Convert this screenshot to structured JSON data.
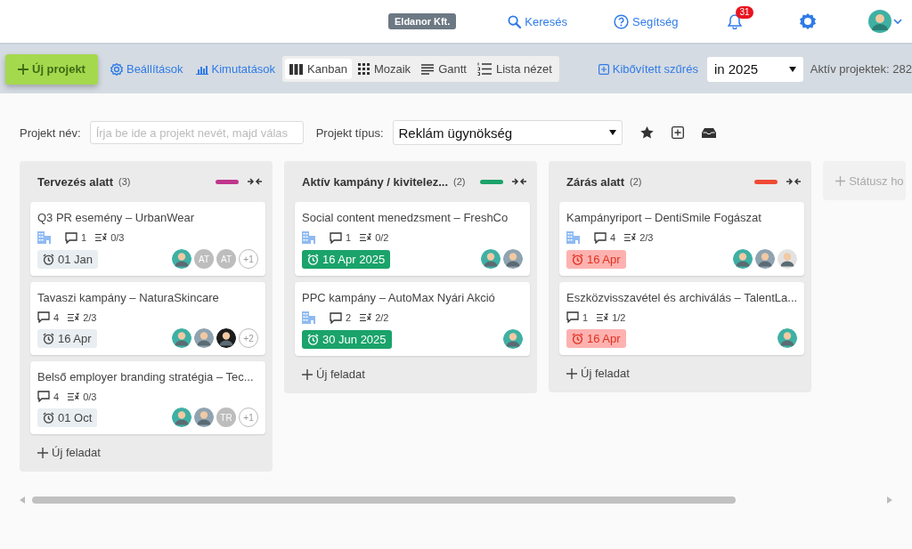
{
  "topbar": {
    "company": "Eldanor Kft.",
    "search": "Keresés",
    "help": "Segítség",
    "notifications": "31"
  },
  "toolbar": {
    "new_project": "Új projekt",
    "settings": "Beállítások",
    "reports": "Kimutatások",
    "views": [
      {
        "label": "Kanban",
        "kind": "kanban",
        "selected": true
      },
      {
        "label": "Mozaik",
        "kind": "grid",
        "selected": false
      },
      {
        "label": "Gantt",
        "kind": "gantt",
        "selected": false
      },
      {
        "label": "Lista nézet",
        "kind": "list",
        "selected": false
      }
    ],
    "advanced_filter": "Kibővített szűrés",
    "year": "in 2025",
    "active_projects": "Aktív projektek: 282"
  },
  "filters": {
    "name_label": "Projekt név:",
    "name_placeholder": "Írja be ide a projekt nevét, majd válas",
    "type_label": "Projekt típus:",
    "type_value": "Reklám ügynökség"
  },
  "columns": [
    {
      "title": "Tervezés alatt",
      "count": "(3)",
      "color": "#c0368c",
      "add_task": "Új feladat",
      "cards": [
        {
          "title": "Q3 PR esemény – UrbanWear",
          "client": true,
          "comments": "1",
          "subtasks": "0/3",
          "due": "01 Jan",
          "overdue": false,
          "on_track": false,
          "avatars": [
            {
              "kind": "person",
              "color": "#3fb0a4"
            },
            {
              "kind": "initials",
              "text": "AT"
            },
            {
              "kind": "initials",
              "text": "AT"
            },
            {
              "kind": "more",
              "text": "+1"
            }
          ]
        },
        {
          "title": "Tavaszi kampány – NaturaSkincare",
          "client": false,
          "comments": "4",
          "subtasks": "2/3",
          "due": "16 Apr",
          "overdue": false,
          "on_track": false,
          "avatars": [
            {
              "kind": "person",
              "color": "#3fb0a4"
            },
            {
              "kind": "person",
              "color": "#8fa3b0"
            },
            {
              "kind": "person",
              "color": "#1c1c1c"
            },
            {
              "kind": "more",
              "text": "+2"
            }
          ]
        },
        {
          "title": "Belső employer branding stratégia – Tec...",
          "client": false,
          "comments": "4",
          "subtasks": "0/3",
          "due": "01 Oct",
          "overdue": false,
          "on_track": false,
          "avatars": [
            {
              "kind": "person",
              "color": "#3fb0a4"
            },
            {
              "kind": "person",
              "color": "#8fa3b0"
            },
            {
              "kind": "initials",
              "text": "TR"
            },
            {
              "kind": "more",
              "text": "+1"
            }
          ]
        }
      ]
    },
    {
      "title": "Aktív kampány / kivitelez...",
      "count": "(2)",
      "color": "#1aa36a",
      "add_task": "Új feladat",
      "cards": [
        {
          "title": "Social content menedzsment – FreshCo",
          "client": true,
          "comments": "1",
          "subtasks": "0/2",
          "due": "16 Apr 2025",
          "overdue": false,
          "on_track": true,
          "avatars": [
            {
              "kind": "person",
              "color": "#3fb0a4"
            },
            {
              "kind": "person",
              "color": "#8fa3b0"
            }
          ]
        },
        {
          "title": "PPC kampány – AutoMax Nyári Akció",
          "client": true,
          "comments": "2",
          "subtasks": "2/2",
          "due": "30 Jun 2025",
          "overdue": false,
          "on_track": true,
          "avatars": [
            {
              "kind": "person",
              "color": "#3fb0a4"
            }
          ]
        }
      ]
    },
    {
      "title": "Zárás alatt",
      "count": "(2)",
      "color": "#f04a35",
      "add_task": "Új feladat",
      "cards": [
        {
          "title": "Kampányriport – DentiSmile Fogászat",
          "client": true,
          "comments": "4",
          "subtasks": "2/3",
          "due": "16 Apr",
          "overdue": true,
          "on_track": false,
          "avatars": [
            {
              "kind": "person",
              "color": "#3fb0a4"
            },
            {
              "kind": "person",
              "color": "#8fa3b0"
            },
            {
              "kind": "person",
              "color": "#e2e2e2"
            }
          ]
        },
        {
          "title": "Eszközvisszavétel és archiválás – TalentLa...",
          "client": false,
          "comments": "1",
          "subtasks": "1/2",
          "due": "16 Apr",
          "overdue": true,
          "on_track": false,
          "avatars": [
            {
              "kind": "person",
              "color": "#3fb0a4"
            }
          ]
        }
      ]
    }
  ],
  "add_status": "Státusz ho"
}
